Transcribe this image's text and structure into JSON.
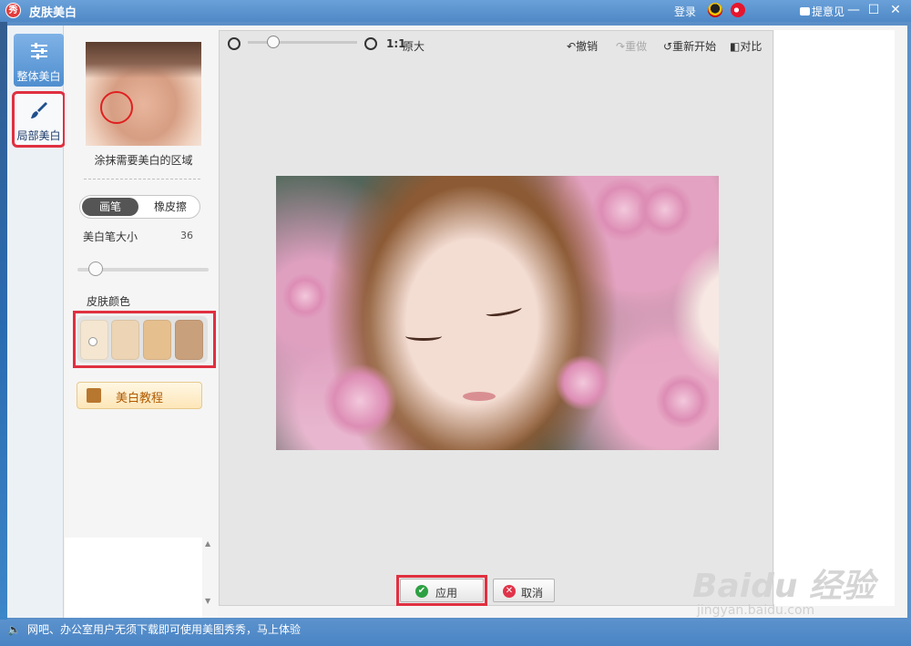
{
  "window": {
    "logo_text": "秀",
    "title": "皮肤美白",
    "login": "登录",
    "feedback": "提意见",
    "minimize": "—",
    "maximize": "☐",
    "close": "✕"
  },
  "sidebar": {
    "tabs": [
      {
        "label": "整体美白",
        "icon": "sliders-icon"
      },
      {
        "label": "局部美白",
        "icon": "brush-icon"
      }
    ]
  },
  "panel": {
    "hint": "涂抹需要美白的区域",
    "brush_label": "画笔",
    "eraser_label": "橡皮擦",
    "size_label": "美白笔大小",
    "size_value": "36",
    "size_fraction": 0.14,
    "skin_label": "皮肤颜色",
    "swatches": [
      "#f4e6d0",
      "#ecd4b4",
      "#e6bf8f",
      "#c9a07c"
    ],
    "selected_swatch": 0,
    "tutorial_label": "美白教程"
  },
  "toolbar": {
    "ratio": "1:1",
    "ratio_text": "原大",
    "undo": "撤销",
    "redo": "重做",
    "restart": "重新开始",
    "compare": "对比"
  },
  "actions": {
    "apply": "应用",
    "cancel": "取消"
  },
  "status": {
    "text": "网吧、办公室用户无须下载即可使用美图秀秀，马上体验"
  },
  "watermark": {
    "logo": "Baidu 经验",
    "url": "jingyan.baidu.com"
  }
}
